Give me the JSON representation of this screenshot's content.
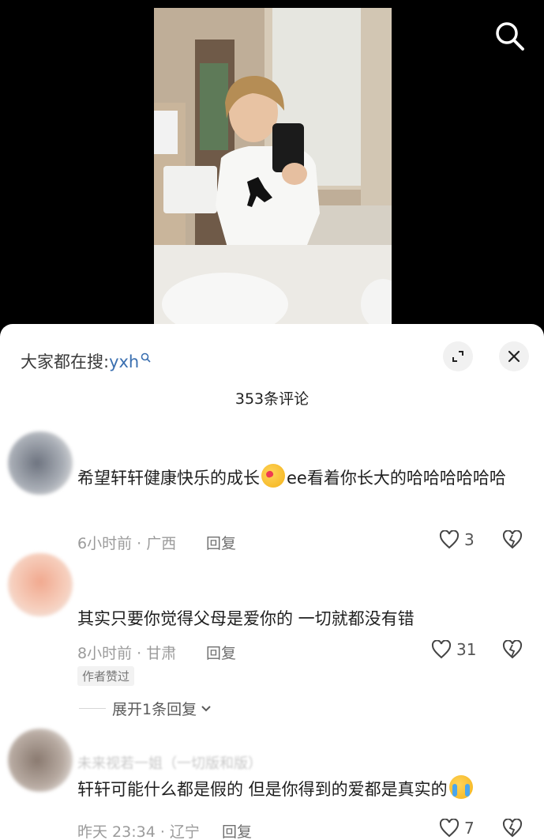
{
  "search_icon": "search-icon",
  "sheet": {
    "search_prefix": "大家都在搜:",
    "search_term": "yxh",
    "title": "353条评论"
  },
  "comments": [
    {
      "username": "",
      "text_before": "希望轩轩健康快乐的成长",
      "emoji": "kiss-face-emoji",
      "text_after": "ee看着你长大的哈哈哈哈哈哈",
      "meta": "6小时前 · 广西",
      "reply_label": "回复",
      "likes": "3"
    },
    {
      "username": "",
      "text": "其实只要你觉得父母是爱你的 一切就都没有错",
      "meta": "8小时前 · 甘肃",
      "reply_label": "回复",
      "likes": "31",
      "badge": "作者赞过",
      "expand_label": "展开1条回复"
    },
    {
      "username": "未来视若一姐（一切版和版）",
      "text_before": "轩轩可能什么都是假的 但是你得到的爱都是真实的",
      "emoji": "loudly-crying-emoji",
      "meta": "昨天 23:34 · 辽宁",
      "reply_label": "回复",
      "likes": "7"
    }
  ]
}
